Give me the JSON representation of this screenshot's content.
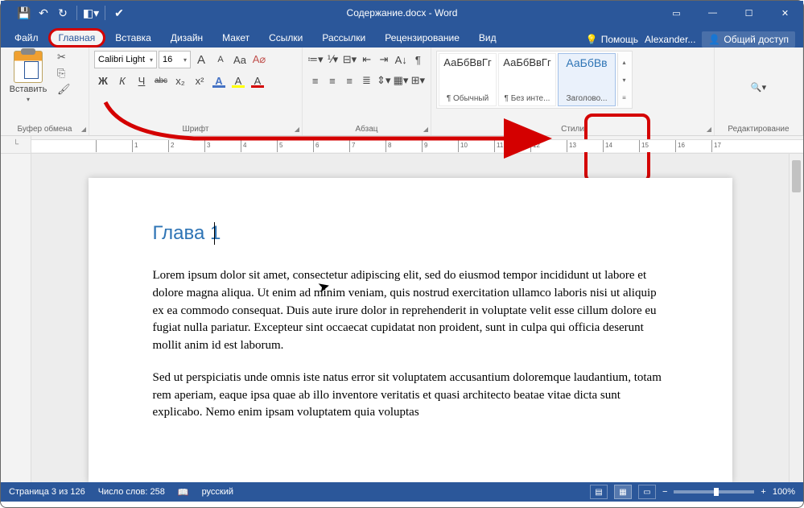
{
  "app_title": "Содержание.docx - Word",
  "qat": {
    "save": "save-icon",
    "undo": "undo-icon",
    "redo": "redo-icon",
    "touch": "touch-icon",
    "spelling": "spelling-icon"
  },
  "tabs": {
    "file": "Файл",
    "home": "Главная",
    "insert": "Вставка",
    "design": "Дизайн",
    "layout": "Макет",
    "references": "Ссылки",
    "mailings": "Рассылки",
    "review": "Рецензирование",
    "view": "Вид",
    "tell_me": "Помощь",
    "user": "Alexander...",
    "share": "Общий доступ"
  },
  "ribbon": {
    "clipboard": {
      "paste": "Вставить",
      "label": "Буфер обмена"
    },
    "font": {
      "name": "Calibri Light",
      "size": "16",
      "grow": "A",
      "shrink": "A",
      "case": "Aa",
      "clear": "A",
      "bold": "Ж",
      "italic": "К",
      "underline": "Ч",
      "strike": "abc",
      "sub": "x₂",
      "sup": "x²",
      "effects": "A",
      "highlight": "A",
      "color": "A",
      "label": "Шрифт"
    },
    "paragraph": {
      "label": "Абзац",
      "bullets": "•",
      "numbers": "1",
      "multilevel": "≡",
      "dec_indent": "⇤",
      "inc_indent": "⇥",
      "sort": "A↓",
      "show": "¶",
      "align_l": "≡",
      "align_c": "≡",
      "align_r": "≡",
      "justify": "≡",
      "spacing": "⇕",
      "shading": "▦",
      "borders": "⊞"
    },
    "styles": {
      "label": "Стили",
      "items": [
        {
          "preview": "АаБбВвГг",
          "name": "¶ Обычный",
          "heading": false
        },
        {
          "preview": "АаБбВвГг",
          "name": "¶ Без инте...",
          "heading": false
        },
        {
          "preview": "АаБбВв",
          "name": "Заголово...",
          "heading": true
        }
      ]
    },
    "editing": {
      "label": "Редактирование",
      "find": "Найти"
    }
  },
  "document": {
    "heading": "Глава 1",
    "para1": "Lorem ipsum dolor sit amet, consectetur adipiscing elit, sed do eiusmod tempor incididunt ut labore et dolore magna aliqua. Ut enim ad minim veniam, quis nostrud exercitation ullamco laboris nisi ut aliquip ex ea commodo consequat. Duis aute irure dolor in reprehenderit in voluptate velit esse cillum dolore eu fugiat nulla pariatur. Excepteur sint occaecat cupidatat non proident, sunt in culpa qui officia deserunt mollit anim id est laborum.",
    "para2": "Sed ut perspiciatis unde omnis iste natus error sit voluptatem accusantium doloremque laudantium, totam rem aperiam, eaque ipsa quae ab illo inventore veritatis et quasi architecto beatae vitae dicta sunt explicabo. Nemo enim ipsam voluptatem quia voluptas"
  },
  "status": {
    "page": "Страница 3 из 126",
    "words": "Число слов: 258",
    "lang": "русский",
    "zoom": "100%"
  },
  "ruler_numbers": [
    "",
    "1",
    "2",
    "3",
    "4",
    "5",
    "6",
    "7",
    "8",
    "9",
    "10",
    "11",
    "12",
    "13",
    "14",
    "15",
    "16",
    "17"
  ]
}
